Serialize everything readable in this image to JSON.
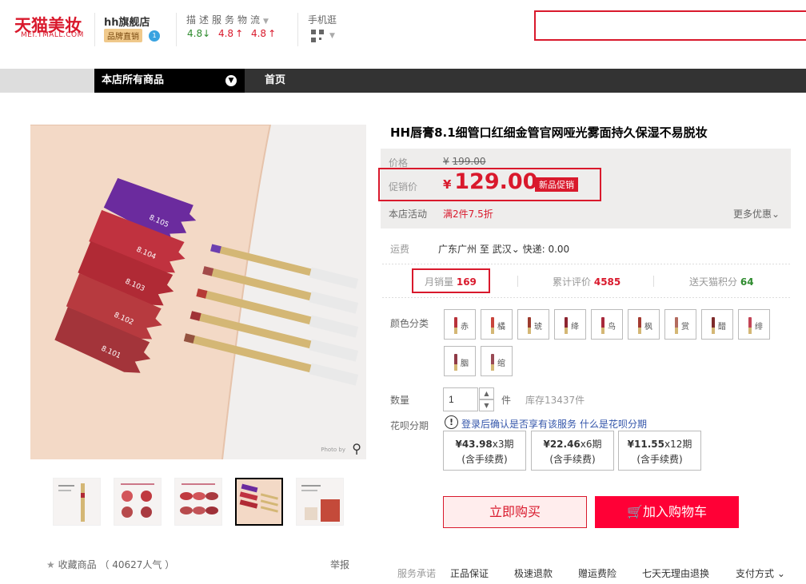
{
  "header": {
    "logo_main": "天猫美妆",
    "logo_sub": "MEI.TMALL.COM",
    "shop_name": "hh旗舰店",
    "shop_badge": "品牌直销",
    "score_label": "描述服务物流",
    "score_desc": "4.8",
    "score_service": "4.8",
    "score_logistics": "4.8",
    "mobile_label": "手机逛"
  },
  "nav": {
    "all_products": "本店所有商品",
    "home": "首页"
  },
  "gallery": {
    "watermark": "Photo by",
    "thumbnails": [
      "thumbnail-1",
      "thumbnail-2",
      "thumbnail-3",
      "thumbnail-4",
      "thumbnail-5"
    ],
    "active_index": 3,
    "favorite_label": "收藏商品",
    "favorite_count": "（ 40627人气 ）",
    "report": "举报"
  },
  "product": {
    "title": "HH唇膏8.1细管口红细金管官网哑光雾面持久保湿不易脱妆",
    "price_label": "价格",
    "original_price": "199.00",
    "promo_label": "促销价",
    "promo_price": "129.00",
    "currency": "¥",
    "promo_tag": "新品促销",
    "activity_label": "本店活动",
    "activity_text": "满2件7.5折",
    "more_offers": "更多优惠",
    "shipping_label": "运费",
    "shipping_from": "广东广州",
    "shipping_to_word": "至",
    "shipping_to": "武汉",
    "shipping_cost": "快递: 0.00",
    "monthly_sales_label": "月销量",
    "monthly_sales": "169",
    "reviews_label": "累计评价",
    "reviews": "4585",
    "points_label": "送天猫积分",
    "points": "64",
    "color_label": "颜色分类",
    "colors": [
      {
        "char": "赤",
        "color": "#b8323a"
      },
      {
        "char": "橘",
        "color": "#c9443b"
      },
      {
        "char": "琥",
        "color": "#9c3b2e"
      },
      {
        "char": "绛",
        "color": "#8c2430"
      },
      {
        "char": "鸟",
        "color": "#a8283c"
      },
      {
        "char": "枫",
        "color": "#a33a31"
      },
      {
        "char": "赏",
        "color": "#b36b5f"
      },
      {
        "char": "醋",
        "color": "#7e2a2a"
      },
      {
        "char": "绯",
        "color": "#c24456"
      },
      {
        "char": "胭",
        "color": "#8f3a46"
      },
      {
        "char": "绾",
        "color": "#9a4a55"
      }
    ],
    "quantity_label": "数量",
    "quantity": "1",
    "unit": "件",
    "stock": "库存13437件",
    "huabei_label": "花呗分期",
    "huabei_note": "登录后确认是否享有该服务",
    "huabei_link": "什么是花呗分期",
    "installments": [
      {
        "amount": "¥43.98",
        "periods": "x3期",
        "fee": "(含手续费)"
      },
      {
        "amount": "¥22.46",
        "periods": "x6期",
        "fee": "(含手续费)"
      },
      {
        "amount": "¥11.55",
        "periods": "x12期",
        "fee": "(含手续费)"
      }
    ],
    "buy_now": "立即购买",
    "add_to_cart": "加入购物车"
  },
  "services": {
    "label": "服务承诺",
    "items": [
      "正品保证",
      "极速退款",
      "赠运费险",
      "七天无理由退换"
    ],
    "payment": "支付方式"
  },
  "colors": {
    "brand_red": "#d9192c",
    "cart_red": "#ff0036"
  }
}
